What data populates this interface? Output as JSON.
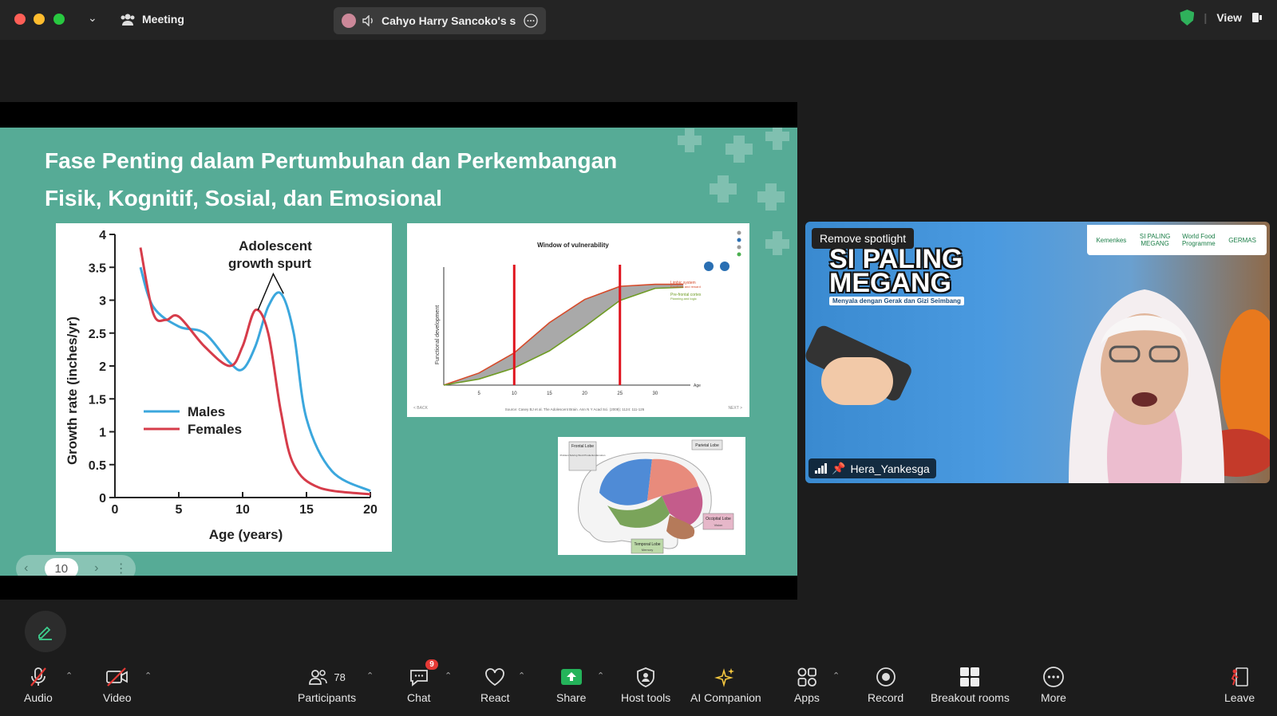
{
  "titlebar": {
    "meeting_label": "Meeting",
    "active_speaker": "Cahyo Harry Sancoko's s",
    "view_label": "View"
  },
  "slide": {
    "title_line1": "Fase Penting dalam Pertumbuhan dan Perkembangan",
    "title_line2": "Fisik, Kognitif, Sosial, dan Emosional",
    "page_number": "10"
  },
  "chart_data": [
    {
      "type": "line",
      "title": "Adolescent growth spurt",
      "ylabel": "Growth rate (inches/yr)",
      "xlabel": "Age (years)",
      "xlim": [
        0,
        20
      ],
      "ylim": [
        0,
        4
      ],
      "x_ticks": [
        "0",
        "5",
        "10",
        "15",
        "20"
      ],
      "y_ticks": [
        "0",
        "0.5",
        "1",
        "1.5",
        "2",
        "2.5",
        "3",
        "3.5",
        "4"
      ],
      "legend": "left-middle",
      "series": [
        {
          "name": "Males",
          "color": "#3ba7dd",
          "x": [
            2,
            3,
            5,
            7,
            9,
            10,
            11,
            12,
            13,
            14,
            15,
            17,
            20
          ],
          "y": [
            3.5,
            2.9,
            2.6,
            2.5,
            2.05,
            1.95,
            2.3,
            2.9,
            3.1,
            2.5,
            1.2,
            0.4,
            0.1
          ]
        },
        {
          "name": "Females",
          "color": "#d63c4a",
          "x": [
            2,
            3,
            4,
            5,
            7,
            9,
            10,
            11,
            12,
            13,
            14,
            16,
            20
          ],
          "y": [
            3.8,
            2.8,
            2.7,
            2.75,
            2.3,
            2.0,
            2.3,
            2.85,
            2.5,
            1.3,
            0.5,
            0.15,
            0.05
          ]
        }
      ]
    },
    {
      "type": "line",
      "title": "Window of vulnerability",
      "ylabel": "Functional development",
      "xlabel": "Age",
      "xlim": [
        0,
        35
      ],
      "x_ticks": [
        "5",
        "10",
        "15",
        "20",
        "25",
        "30"
      ],
      "series": [
        {
          "name": "Limbic system",
          "color": "#d64a2a",
          "x": [
            0,
            5,
            10,
            15,
            20,
            25,
            30,
            34
          ],
          "y": [
            0.0,
            0.12,
            0.32,
            0.62,
            0.85,
            0.98,
            1.0,
            1.0
          ]
        },
        {
          "name": "Pre-frontal cortex",
          "color": "#6f9c25",
          "x": [
            0,
            5,
            10,
            15,
            20,
            25,
            30,
            34
          ],
          "y": [
            0.0,
            0.06,
            0.17,
            0.34,
            0.58,
            0.84,
            0.96,
            0.97
          ]
        }
      ],
      "vertical_markers": [
        10,
        25
      ],
      "legend_notes": [
        "Emotions and reward",
        "Planning and logic"
      ],
      "footer_left": "< BACK",
      "footer_right": "NEXT >",
      "source": "Source: Casey BJ et al. The Adolescent Brain. Ann N Y Acad Sci. (2008); 1124: 111-126"
    }
  ],
  "brain": {
    "frontal": "Frontal Lobe",
    "frontal_sub": "Problem Solving Word Production Emotion",
    "parietal": "Parietal Lobe",
    "occipital": "Occipital Lobe",
    "occipital_sub": "Vision",
    "temporal": "Temporal Lobe",
    "temporal_sub": "Memory"
  },
  "video": {
    "spotlight_button": "Remove spotlight",
    "participant_name": "Hera_Yankesga",
    "brand_line1": "SI PALING",
    "brand_line2": "MEGANG",
    "brand_sub": "Menyala dengan Gerak dan Gizi Seimbang",
    "logos": [
      "Kemenkes",
      "SI PALING MEGANG",
      "World Food Programme",
      "GERMAS"
    ]
  },
  "toolbar": {
    "audio": "Audio",
    "video": "Video",
    "participants": "Participants",
    "participant_count": "78",
    "chat": "Chat",
    "chat_badge": "9",
    "react": "React",
    "share": "Share",
    "host_tools": "Host tools",
    "ai_companion": "AI Companion",
    "apps": "Apps",
    "record": "Record",
    "breakout_rooms": "Breakout rooms",
    "more": "More",
    "leave": "Leave"
  }
}
